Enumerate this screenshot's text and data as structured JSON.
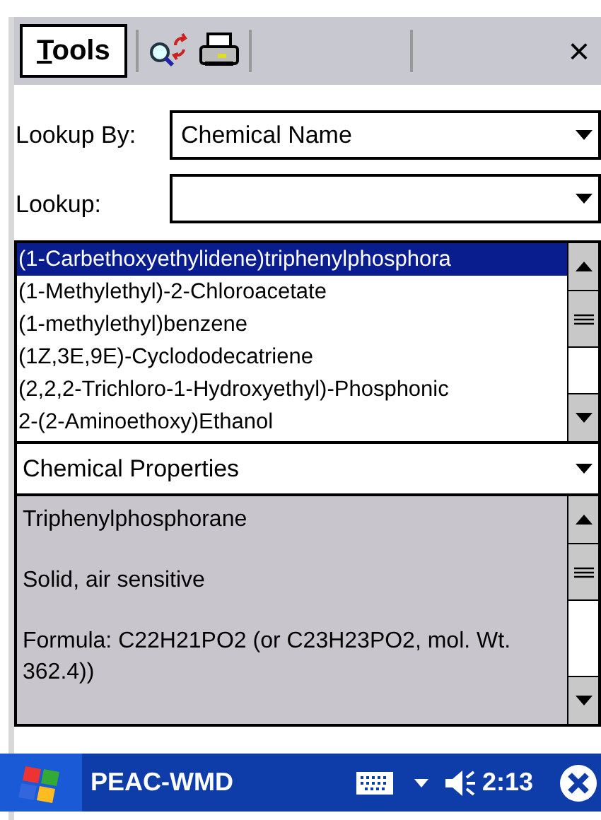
{
  "toolbar": {
    "menu": "Tools",
    "close": "×"
  },
  "lookup_by": {
    "label": "Lookup By:",
    "value": "Chemical Name"
  },
  "lookup": {
    "label": "Lookup:"
  },
  "results": [
    {
      "name": "(1-Carbethoxyethylidene)triphenylphosphora",
      "selected": true
    },
    {
      "name": "(1-Methylethyl)-2-Chloroacetate",
      "selected": false
    },
    {
      "name": "(1-methylethyl)benzene",
      "selected": false
    },
    {
      "name": "(1Z,3E,9E)-Cyclododecatriene",
      "selected": false
    },
    {
      "name": "(2,2,2-Trichloro-1-Hydroxyethyl)-Phosphonic",
      "selected": false
    },
    {
      "name": "2-(2-Aminoethoxy)Ethanol",
      "selected": false
    }
  ],
  "section": {
    "value": "Chemical Properties"
  },
  "properties": [
    "Triphenylphosphorane",
    "Solid, air sensitive",
    "Formula: C22H21PO2 (or C23H23PO2, mol. Wt. 362.4))"
  ],
  "taskbar": {
    "title": "PEAC-WMD",
    "time": "2:13"
  }
}
